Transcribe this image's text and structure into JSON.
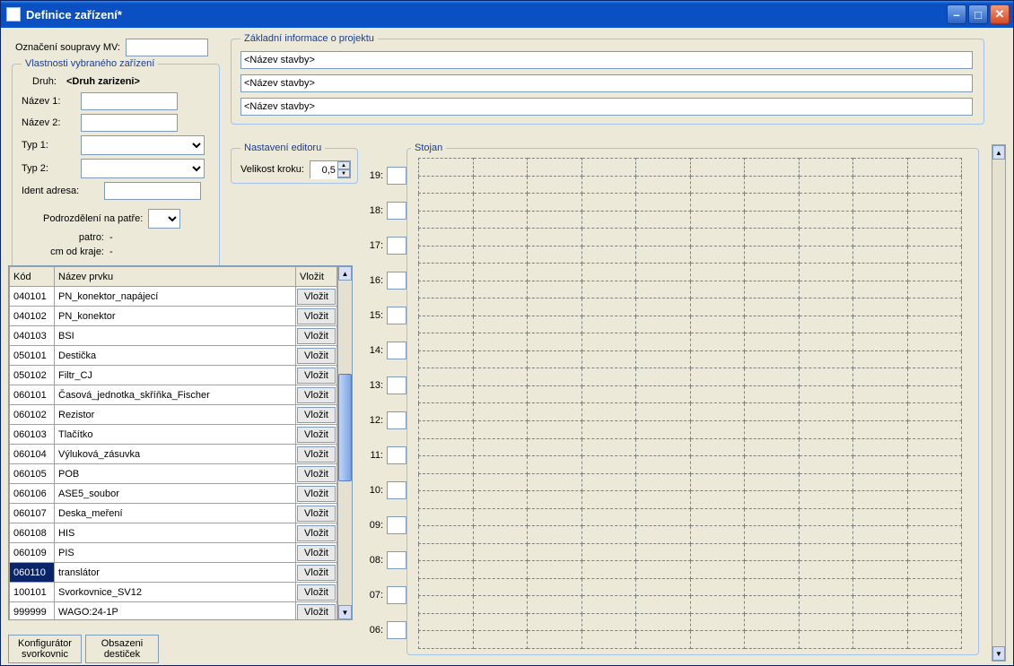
{
  "window": {
    "title": "Definice zařízení*"
  },
  "labels": {
    "oznaceni_soupravy": "Označení soupravy MV:",
    "vlastnosti_group": "Vlastnosti vybraného zařízení",
    "druh_label": "Druh:",
    "druh_value": "<Druh zarizeni>",
    "nazev1": "Název 1:",
    "nazev2": "Název 2:",
    "typ1": "Typ 1:",
    "typ2": "Typ 2:",
    "ident_adresa": "Ident adresa:",
    "podrozdeleni": "Podrozdělení na patře:",
    "patro": "patro:",
    "patro_val": "-",
    "cm_od_kraje": "cm od kraje:",
    "cm_val": "-",
    "projekt_group": "Základní informace o projektu",
    "proj_placeholder": "<Název stavby>",
    "editor_group": "Nastavení editoru",
    "velikost_kroku": "Velikost kroku:",
    "velikost_value": "0,5",
    "stojan_group": "Stojan",
    "vlozit": "Vložit",
    "konfig_btn": "Konfigurátor\nsvorkovnic",
    "obsazen_btn": "Obsazeni\ndestiček"
  },
  "table": {
    "headers": {
      "kod": "Kód",
      "nazev": "Název prvku",
      "vlozit": "Vložit"
    },
    "selected_code": "060110",
    "rows": [
      {
        "kod": "040101",
        "nazev": "PN_konektor_napájecí"
      },
      {
        "kod": "040102",
        "nazev": "PN_konektor"
      },
      {
        "kod": "040103",
        "nazev": "BSI"
      },
      {
        "kod": "050101",
        "nazev": "Destička"
      },
      {
        "kod": "050102",
        "nazev": "Filtr_CJ"
      },
      {
        "kod": "060101",
        "nazev": "Časová_jednotka_skříňka_Fischer"
      },
      {
        "kod": "060102",
        "nazev": "Rezistor"
      },
      {
        "kod": "060103",
        "nazev": "Tlačítko"
      },
      {
        "kod": "060104",
        "nazev": "Výluková_zásuvka"
      },
      {
        "kod": "060105",
        "nazev": "POB"
      },
      {
        "kod": "060106",
        "nazev": "ASE5_soubor"
      },
      {
        "kod": "060107",
        "nazev": "Deska_meření"
      },
      {
        "kod": "060108",
        "nazev": "HIS"
      },
      {
        "kod": "060109",
        "nazev": "PIS"
      },
      {
        "kod": "060110",
        "nazev": "translátor"
      },
      {
        "kod": "100101",
        "nazev": "Svorkovnice_SV12"
      },
      {
        "kod": "999999",
        "nazev": "WAGO:24-1P"
      }
    ]
  },
  "rack_rows": [
    "19",
    "18",
    "17",
    "16",
    "15",
    "14",
    "13",
    "12",
    "11",
    "10",
    "09",
    "08",
    "07",
    "06"
  ]
}
